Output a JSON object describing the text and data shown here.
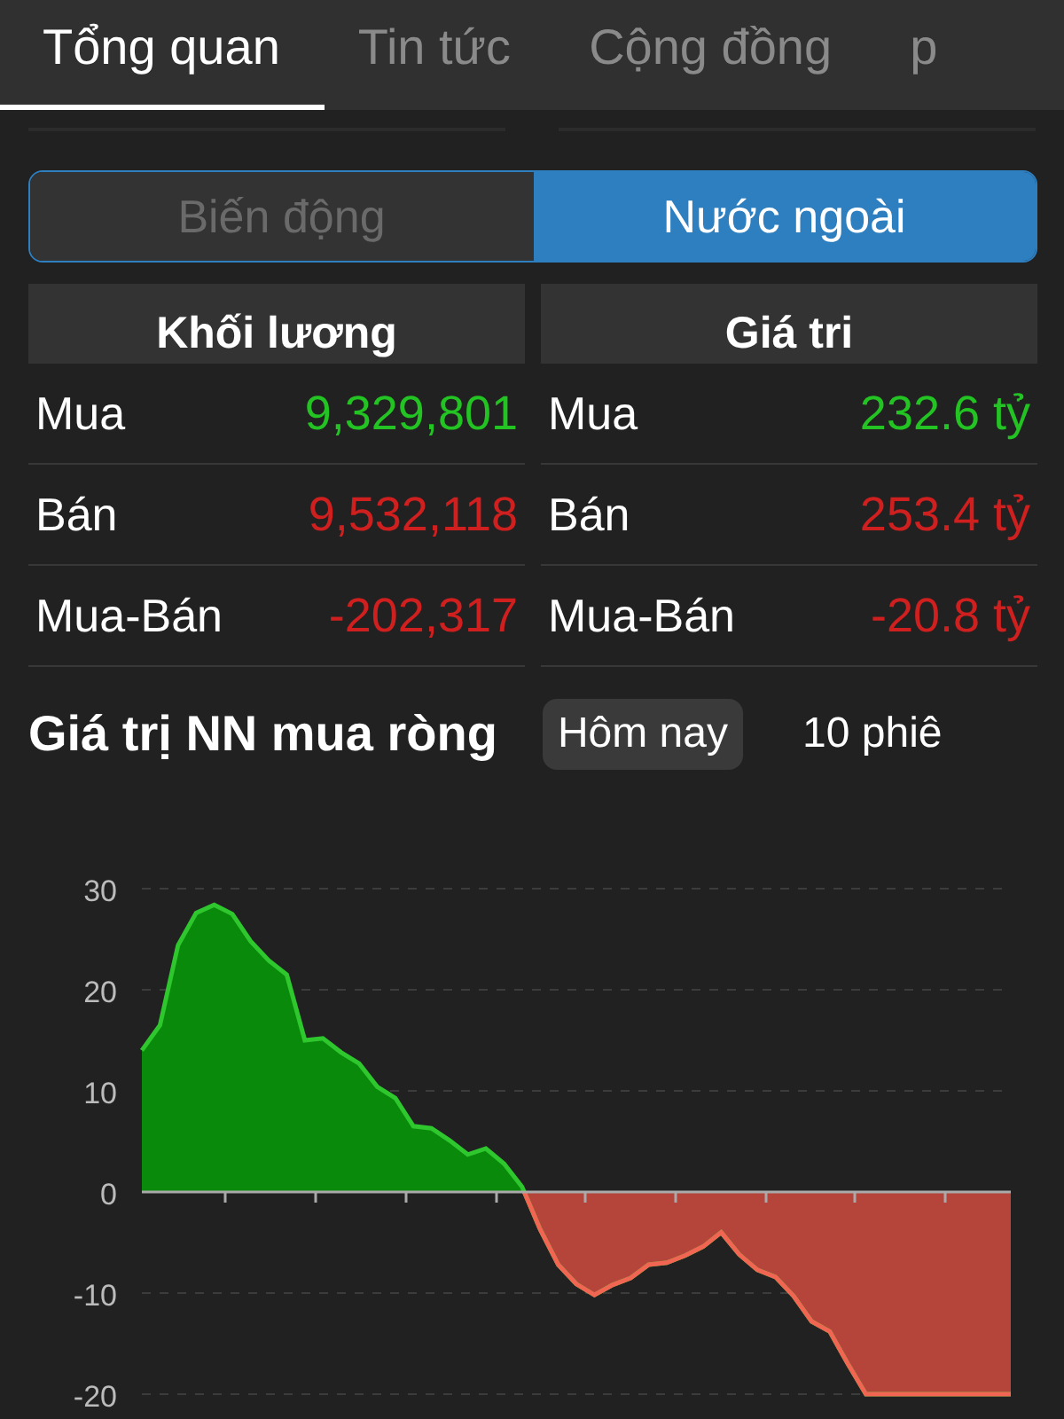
{
  "tabs": [
    {
      "label": "Tổng quan",
      "selected": true
    },
    {
      "label": "Tin tức",
      "selected": false
    },
    {
      "label": "Cộng đồng",
      "selected": false
    },
    {
      "label": "p",
      "selected": false
    }
  ],
  "segments": [
    {
      "label": "Biến động",
      "selected": false
    },
    {
      "label": "Nước ngoài",
      "selected": true
    }
  ],
  "tables": [
    {
      "header": "Khối lương",
      "rows": [
        {
          "label": "Mua",
          "value": "9,329,801",
          "color": "#22c322"
        },
        {
          "label": "Bán",
          "value": "9,532,118",
          "color": "#d01f1f"
        },
        {
          "label": "Mua-Bán",
          "value": "-202,317",
          "color": "#d01f1f"
        }
      ]
    },
    {
      "header": "Giá tri",
      "rows": [
        {
          "label": "Mua",
          "value": "232.6 tỷ",
          "color": "#22c322"
        },
        {
          "label": "Bán",
          "value": "253.4 tỷ",
          "color": "#d01f1f"
        },
        {
          "label": "Mua-Bán",
          "value": "-20.8 tỷ",
          "color": "#d01f1f"
        }
      ]
    }
  ],
  "net_chart": {
    "title": "Giá trị NN mua ròng",
    "periods": [
      {
        "label": "Hôm nay",
        "selected": true
      },
      {
        "label": "10 phiê",
        "selected": false
      }
    ],
    "chart_data": {
      "type": "area",
      "categories": [
        null,
        null,
        null,
        null,
        null,
        null,
        null,
        null,
        null,
        null,
        null,
        null,
        null,
        null,
        null,
        null,
        null,
        null,
        null,
        null,
        null,
        null,
        null,
        null,
        null,
        null,
        null,
        null,
        null,
        null,
        null,
        null,
        null,
        null,
        null,
        null,
        null,
        null,
        null,
        null,
        null,
        null,
        null,
        null,
        null,
        null,
        null,
        null,
        null
      ],
      "series": [
        {
          "color": "#2ec72e",
          "values": [
            14,
            16.5,
            24.4,
            27.6,
            28.4,
            27.5,
            24.8,
            22.9,
            21.5,
            15,
            15.2,
            13.8,
            12.7,
            10.4,
            9.3,
            6.5,
            6.3,
            5.1,
            3.7,
            4.3,
            2.8,
            0.5,
            -3.7,
            -7.2,
            -9.1,
            -10.2,
            -9.2,
            -8.5,
            -7.2,
            -7,
            -6.3,
            -5.4,
            -4,
            -6.2,
            -7.7,
            -8.4,
            -10.3,
            -12.8,
            -13.8,
            -17,
            -20,
            -20,
            -20,
            -20,
            -20,
            -20,
            -20,
            -20,
            -20
          ]
        }
      ],
      "grid": true,
      "ylim": [
        -20,
        30
      ],
      "yticks": [
        -20,
        -10,
        0,
        10,
        20,
        30
      ]
    }
  }
}
